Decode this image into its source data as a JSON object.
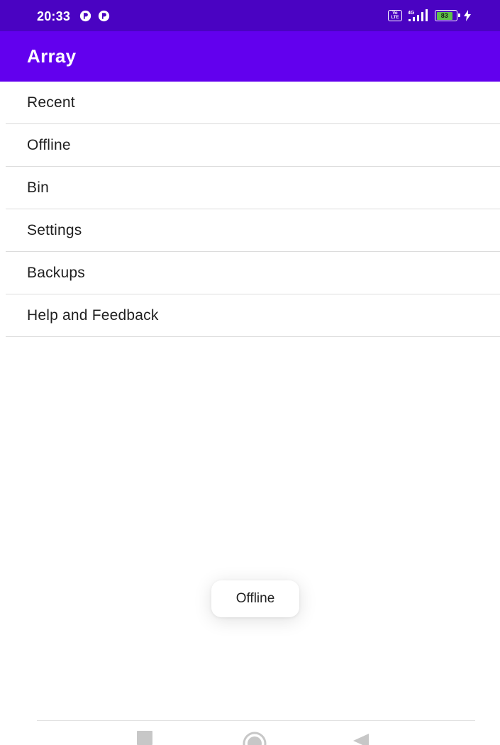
{
  "status_bar": {
    "time": "20:33",
    "app_icons": [
      "podcast-app-icon",
      "podcast-app-icon"
    ],
    "volte_label_top": "Vo",
    "volte_label_bottom": "LTE",
    "network_label": "4G",
    "battery_level": "83",
    "battery_fraction": 0.83,
    "charging": true
  },
  "app_bar": {
    "title": "Array"
  },
  "menu": {
    "items": [
      {
        "label": "Recent"
      },
      {
        "label": "Offline"
      },
      {
        "label": "Bin"
      },
      {
        "label": "Settings"
      },
      {
        "label": "Backups"
      },
      {
        "label": "Help and Feedback"
      }
    ]
  },
  "toast": {
    "text": "Offline"
  },
  "navigation_bar": {
    "buttons": [
      "recents-square-icon",
      "home-circle-icon",
      "back-triangle-icon"
    ]
  },
  "colors": {
    "status_bar": "#4a03c2",
    "app_bar": "#6200ee",
    "battery_fill": "#5ec34a",
    "divider": "#dcdcdc"
  }
}
